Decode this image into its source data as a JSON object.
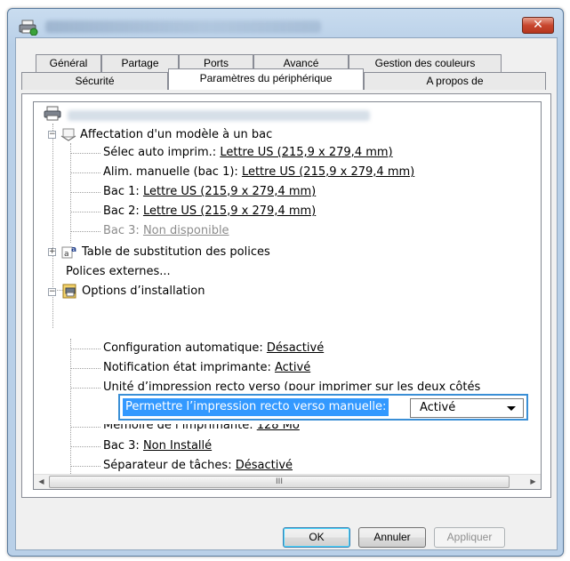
{
  "window": {
    "close_symbol": "✕"
  },
  "tabs": {
    "row1": [
      "Général",
      "Partage",
      "Ports",
      "Avancé",
      "Gestion des couleurs"
    ],
    "row2": [
      "Sécurité",
      "Paramètres du périphérique",
      "A propos de"
    ],
    "selected": "Paramètres du périphérique"
  },
  "tree": {
    "section1": {
      "label": "Affectation d'un modèle à un bac",
      "items": [
        {
          "label": "Sélec auto imprim.: ",
          "value": "Lettre US (215,9 x 279,4 mm)"
        },
        {
          "label": "Alim. manuelle (bac 1): ",
          "value": "Lettre US (215,9 x 279,4 mm)"
        },
        {
          "label": "Bac 1: ",
          "value": "Lettre US (215,9 x 279,4 mm)"
        },
        {
          "label": "Bac 2: ",
          "value": "Lettre US (215,9 x 279,4 mm)"
        },
        {
          "label": "Bac 3: ",
          "value": "Non disponible"
        }
      ]
    },
    "section2": {
      "label": "Table de substitution des polices"
    },
    "section3": {
      "label": "Polices externes..."
    },
    "section4": {
      "label": "Options d’installation",
      "items": [
        {
          "label": "Configuration automatique: ",
          "value": "Désactivé"
        },
        {
          "label": "Notification état imprimante: ",
          "value": "Activé"
        },
        {
          "label": "Unité d’impression recto verso (pour imprimer sur les deux côtés",
          "value": ""
        },
        {
          "label": "Mémoire de l’imprimante: ",
          "value": "128 Mo"
        },
        {
          "label": "Bac 3: ",
          "value": "Non Installé"
        },
        {
          "label": "Séparateur de tâches: ",
          "value": "Désactivé"
        }
      ],
      "editing": {
        "label": "Permettre l’impression recto verso manuelle:",
        "value": "Activé"
      }
    }
  },
  "scrollbar": {
    "thumb_grip": "III",
    "left_arrow": "◀",
    "right_arrow": "▶"
  },
  "buttons": {
    "ok": "OK",
    "cancel": "Annuler",
    "apply": "Appliquer"
  },
  "colors": {
    "selection": "#3399ff",
    "focus_border": "#3a8fd6",
    "close_button": "#c8472f"
  }
}
